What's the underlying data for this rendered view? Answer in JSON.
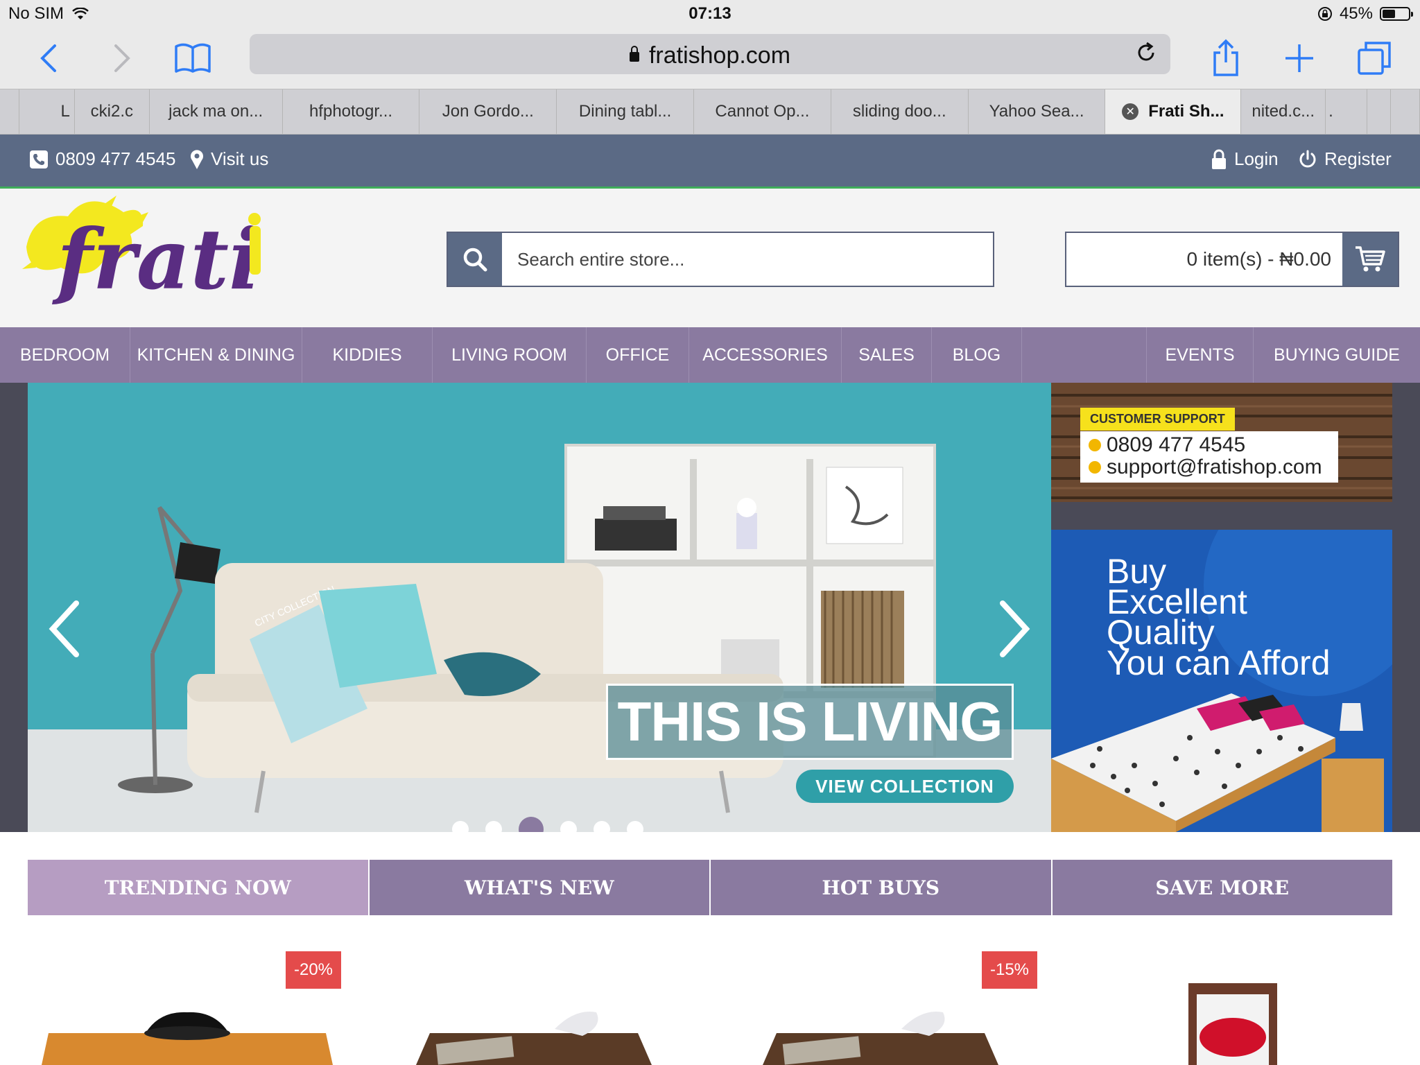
{
  "status_bar": {
    "carrier": "No SIM",
    "time": "07:13",
    "battery": "45%"
  },
  "browser": {
    "url": "fratishop.com",
    "tabs": [
      "L",
      "cki2.c",
      "jack ma on...",
      "hfphotogr...",
      "Jon Gordo...",
      "Dining tabl...",
      "Cannot Op...",
      "sliding doo...",
      "Yahoo Sea...",
      "Frati Sh...",
      "nited.c...",
      "."
    ],
    "active_tab": "Frati Sh..."
  },
  "topbar": {
    "phone": "0809 477 4545",
    "visit": "Visit us",
    "login": "Login",
    "register": "Register"
  },
  "header": {
    "logo_text": "frati",
    "search_placeholder": "Search entire store...",
    "cart_text": "0 item(s) - ₦0.00"
  },
  "nav": {
    "items": [
      "BEDROOM",
      "KITCHEN & DINING",
      "KIDDIES",
      "LIVING ROOM",
      "OFFICE",
      "ACCESSORIES",
      "SALES",
      "BLOG"
    ],
    "right_items": [
      "EVENTS",
      "BUYING GUIDE"
    ]
  },
  "hero": {
    "headline": "THIS IS LIVING",
    "cta": "VIEW COLLECTION",
    "slide_count": 6,
    "active_slide": 3,
    "pillow_text": "CITY COLLECTION"
  },
  "support_banner": {
    "label": "CUSTOMER SUPPORT",
    "phone": "0809 477 4545",
    "email": "support@fratishop.com"
  },
  "promo_banner": {
    "line1": "Buy",
    "line2": "Excellent",
    "line3": "Quality",
    "line4": "You can Afford"
  },
  "category_tabs": [
    "TRENDING NOW",
    "WHAT'S NEW",
    "HOT BUYS",
    "SAVE MORE"
  ],
  "products": {
    "badges": [
      "-20%",
      "-15%"
    ]
  },
  "colors": {
    "accent_purple": "#8a7aa0",
    "slate": "#5b6a85",
    "hero_teal": "#3ba6b3",
    "badge_red": "#e44b4b"
  }
}
